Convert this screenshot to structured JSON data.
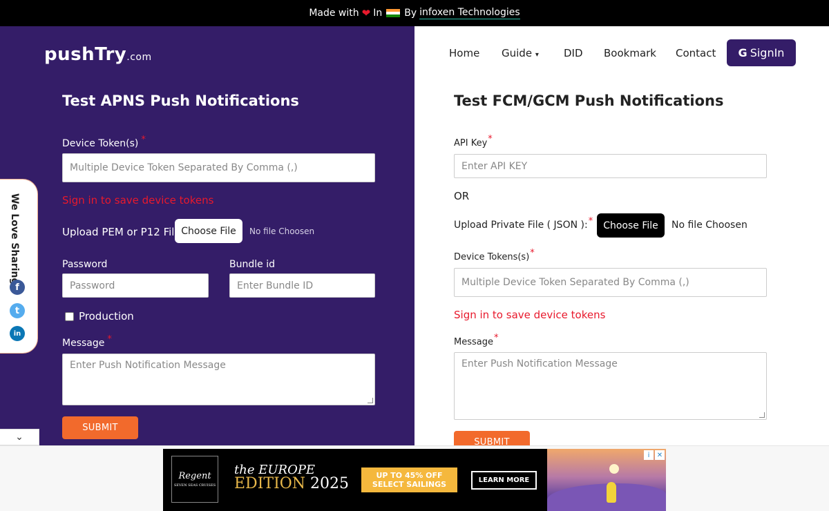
{
  "topbar": {
    "made_with": "Made with",
    "in": "In",
    "by": "By",
    "company": "infoxen Technologies"
  },
  "logo": {
    "name": "pushTry",
    "domain": ".com"
  },
  "nav": {
    "home": "Home",
    "guide": "Guide",
    "did": "DID",
    "bookmark": "Bookmark",
    "contact": "Contact",
    "signin": "SignIn",
    "signin_glyph": "G"
  },
  "apns": {
    "title": "Test APNS Push Notifications",
    "device_token_label": "Device Token(s)",
    "device_token_placeholder": "Multiple Device Token Separated By Comma (,)",
    "signin_hint": "Sign in to save device tokens",
    "upload_label": "Upload PEM or P12 File:",
    "choose_file": "Choose File",
    "no_file": "No file Choosen",
    "password_label": "Password",
    "password_placeholder": "Password",
    "bundle_label": "Bundle id",
    "bundle_placeholder": "Enter Bundle ID",
    "production_label": "Production",
    "message_label": "Message",
    "message_placeholder": "Enter Push Notification Message",
    "submit": "SUBMIT"
  },
  "fcm": {
    "title": "Test FCM/GCM Push Notifications",
    "api_key_label": "API Key",
    "api_key_placeholder": "Enter API KEY",
    "or": "OR",
    "upload_label": "Upload Private File ( JSON ):",
    "choose_file": "Choose File",
    "no_file": "No file Choosen",
    "device_tokens_label": "Device Tokens(s)",
    "device_tokens_placeholder": "Multiple Device Token Separated By Comma (,)",
    "signin_hint": "Sign in to save device tokens",
    "message_label": "Message",
    "message_placeholder": "Enter Push Notification Message",
    "submit": "SUBMIT"
  },
  "required_mark": "*",
  "share": {
    "label": "We Love Sharing:",
    "facebook": "f",
    "twitter": "t",
    "linkedin": "in"
  },
  "collapse_glyph": "⌄",
  "ad": {
    "brand": "Regent",
    "brand_sub": "SEVEN SEAS CRUISES",
    "headline_1": "the EUROPE",
    "headline_2": "EDITION",
    "headline_year": "2025",
    "promo_1": "UP TO 45% OFF",
    "promo_2": "SELECT SAILINGS",
    "cta": "LEARN MORE",
    "info_glyph": "i",
    "close_glyph": "✕"
  },
  "colors": {
    "brand_purple": "#341d68",
    "accent_orange": "#f26a2c",
    "error_red": "#e8192c"
  },
  "icons": [
    "heart-icon",
    "india-flag-icon",
    "caret-down-icon",
    "google-icon",
    "facebook-icon",
    "twitter-icon",
    "linkedin-icon",
    "chevron-down-icon",
    "adchoices-icon",
    "close-icon"
  ]
}
